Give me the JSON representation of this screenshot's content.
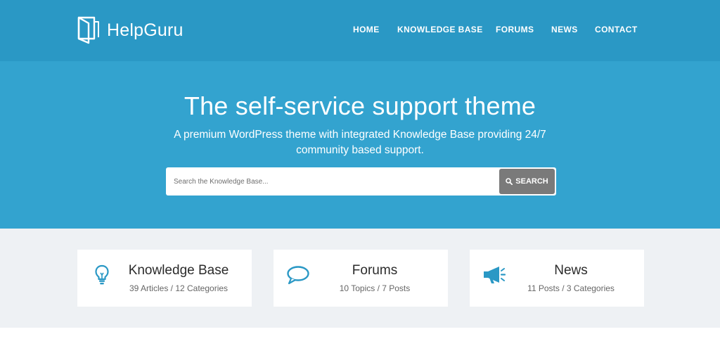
{
  "brand": {
    "name": "HelpGuru",
    "icon": "book-icon"
  },
  "nav": {
    "items": [
      {
        "label": "HOME"
      },
      {
        "label": "KNOWLEDGE BASE"
      },
      {
        "label": "FORUMS"
      },
      {
        "label": "NEWS"
      },
      {
        "label": "CONTACT"
      }
    ]
  },
  "hero": {
    "title": "The self-service support theme",
    "subtitle": "A premium WordPress theme with integrated Knowledge Base providing 24/7 community based support."
  },
  "search": {
    "placeholder": "Search the Knowledge Base...",
    "button_label": "SEARCH",
    "button_icon": "search-icon"
  },
  "cards": [
    {
      "title": "Knowledge Base",
      "meta": "39 Articles / 12 Categories",
      "icon": "lightbulb-icon"
    },
    {
      "title": "Forums",
      "meta": "10 Topics / 7 Posts",
      "icon": "speech-bubble-icon"
    },
    {
      "title": "News",
      "meta": "11 Posts / 3 Categories",
      "icon": "megaphone-icon"
    }
  ],
  "colors": {
    "header_bg": "#2a98c5",
    "hero_bg": "#33a3cf",
    "accent": "#2a98c5",
    "search_button": "#7a7a7a",
    "cards_area_bg": "#eef1f4"
  }
}
